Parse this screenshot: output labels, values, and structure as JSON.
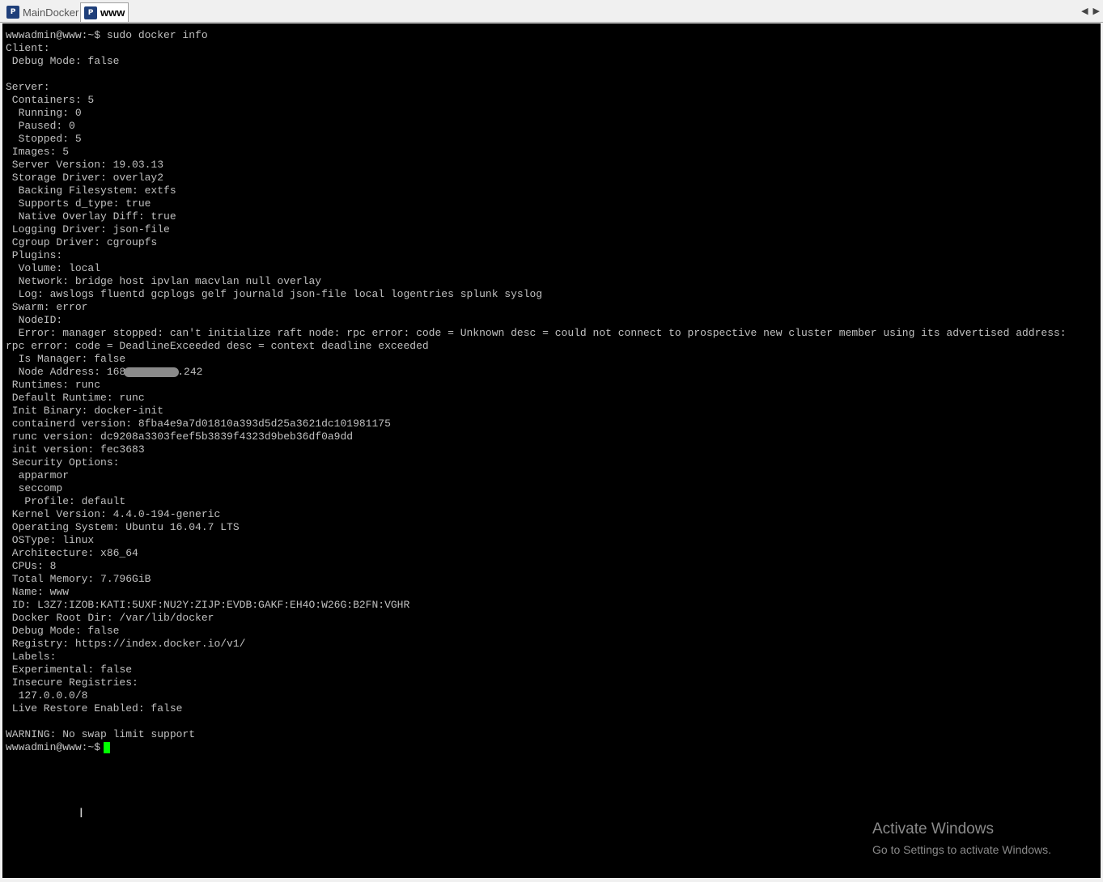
{
  "tabs": [
    {
      "label": "MainDocker",
      "active": false,
      "icon": "putty-icon"
    },
    {
      "label": "www",
      "active": true,
      "icon": "putty-icon"
    }
  ],
  "terminal": {
    "lines": [
      "wwwadmin@www:~$ sudo docker info",
      "Client:",
      " Debug Mode: false",
      "",
      "Server:",
      " Containers: 5",
      "  Running: 0",
      "  Paused: 0",
      "  Stopped: 5",
      " Images: 5",
      " Server Version: 19.03.13",
      " Storage Driver: overlay2",
      "  Backing Filesystem: extfs",
      "  Supports d_type: true",
      "  Native Overlay Diff: true",
      " Logging Driver: json-file",
      " Cgroup Driver: cgroupfs",
      " Plugins:",
      "  Volume: local",
      "  Network: bridge host ipvlan macvlan null overlay",
      "  Log: awslogs fluentd gcplogs gelf journald json-file local logentries splunk syslog",
      " Swarm: error",
      "  NodeID:",
      "  Error: manager stopped: can't initialize raft node: rpc error: code = Unknown desc = could not connect to prospective new cluster member using its advertised address:",
      "rpc error: code = DeadlineExceeded desc = context deadline exceeded",
      "  Is Manager: false"
    ],
    "node_address_prefix": "  Node Address: 168",
    "node_address_suffix": ".242",
    "lines2": [
      " Runtimes: runc",
      " Default Runtime: runc",
      " Init Binary: docker-init",
      " containerd version: 8fba4e9a7d01810a393d5d25a3621dc101981175",
      " runc version: dc9208a3303feef5b3839f4323d9beb36df0a9dd",
      " init version: fec3683",
      " Security Options:",
      "  apparmor",
      "  seccomp",
      "   Profile: default",
      " Kernel Version: 4.4.0-194-generic",
      " Operating System: Ubuntu 16.04.7 LTS",
      " OSType: linux",
      " Architecture: x86_64",
      " CPUs: 8",
      " Total Memory: 7.796GiB",
      " Name: www",
      " ID: L3Z7:IZOB:KATI:5UXF:NU2Y:ZIJP:EVDB:GAKF:EH4O:W26G:B2FN:VGHR",
      " Docker Root Dir: /var/lib/docker",
      " Debug Mode: false",
      " Registry: https://index.docker.io/v1/",
      " Labels:",
      " Experimental: false",
      " Insecure Registries:",
      "  127.0.0.0/8",
      " Live Restore Enabled: false",
      "",
      "WARNING: No swap limit support"
    ],
    "prompt": "wwwadmin@www:~$",
    "cursor_color": "#00ff00"
  },
  "watermark": {
    "title": "Activate Windows",
    "subtitle": "Go to Settings to activate Windows."
  }
}
